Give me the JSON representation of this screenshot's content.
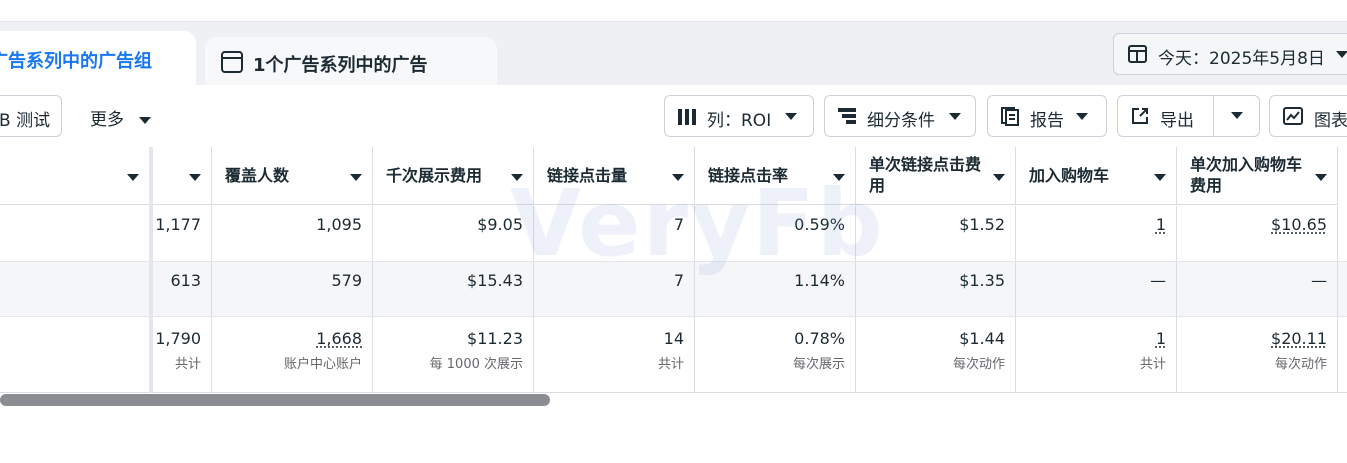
{
  "tabs": {
    "active_label": "广告系列中的广告组",
    "second_label": "1个广告系列中的广告"
  },
  "date": {
    "label": "今天：2025年5月8日"
  },
  "toolbar": {
    "ab_test": "B 测试",
    "more": "更多",
    "columns": "列：ROI",
    "breakdown": "细分条件",
    "reports": "报告",
    "export": "导出",
    "charts": "图表"
  },
  "table": {
    "headers": [
      "覆盖人数",
      "千次展示费用",
      "链接点击量",
      "链接点击率",
      "单次链接点击费用",
      "加入购物车",
      "单次加入购物车费用"
    ],
    "rows": [
      {
        "c0": "1,177",
        "c1": "1,095",
        "c2": "$9.05",
        "c3": "7",
        "c4": "0.59%",
        "c5": "$1.52",
        "c6": "1",
        "c7": "$10.65"
      },
      {
        "c0": "613",
        "c1": "579",
        "c2": "$15.43",
        "c3": "7",
        "c4": "1.14%",
        "c5": "$1.35",
        "c6": "—",
        "c7": "—"
      }
    ],
    "total": {
      "c0": "1,790",
      "c1": "1,668",
      "c2": "$11.23",
      "c3": "14",
      "c4": "0.78%",
      "c5": "$1.44",
      "c6": "1",
      "c7": "$20.11",
      "s0": "共计",
      "s1": "账户中心账户",
      "s2": "每 1000 次展示",
      "s3": "共计",
      "s4": "每次展示",
      "s5": "每次动作",
      "s6": "共计",
      "s7": "每次动作"
    }
  },
  "watermark": "VeryFb",
  "colors": {
    "accent": "#1877f2",
    "row_alt": "#f5f6f7",
    "scrollbar": "#8a8d91"
  }
}
